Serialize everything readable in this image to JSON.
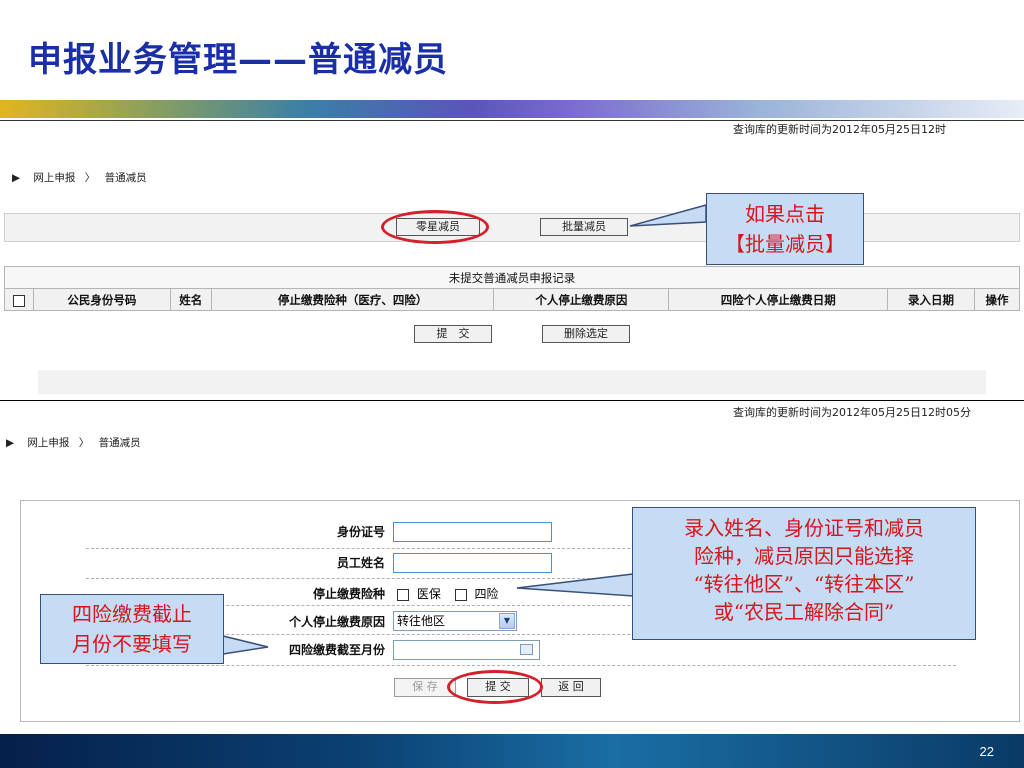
{
  "slide": {
    "title": "申报业务管理——普通减员",
    "page_number": "22"
  },
  "top_screen": {
    "update_time": "查询库的更新时间为2012年05月25日12时",
    "breadcrumb": {
      "arrow": "▶",
      "root": "网上申报",
      "sep": "〉",
      "current": "普通减员"
    },
    "buttons": {
      "zero_reduce": "零星减员",
      "batch_reduce": "批量减员"
    },
    "table": {
      "caption": "未提交普通减员申报记录",
      "headers": [
        "公民身份号码",
        "姓名",
        "停止缴费险种（医疗、四险）",
        "个人停止缴费原因",
        "四险个人停止缴费日期",
        "录入日期",
        "操作"
      ]
    },
    "actions": {
      "submit": "提　交",
      "delete_selected": "删除选定"
    }
  },
  "bottom_screen": {
    "update_time": "查询库的更新时间为2012年05月25日12时05分",
    "breadcrumb": {
      "arrow": "▶",
      "root": "网上申报",
      "sep": "〉",
      "current": "普通减员"
    },
    "form": {
      "id_label": "身份证号",
      "id_value": "",
      "name_label": "员工姓名",
      "name_value": "",
      "insurance_label": "停止缴费险种",
      "insurance_options": [
        {
          "label": "医保",
          "checked": false
        },
        {
          "label": "四险",
          "checked": false
        }
      ],
      "reason_label": "个人停止缴费原因",
      "reason_selected": "转往他区",
      "month_label": "四险缴费截至月份",
      "month_value": ""
    },
    "buttons": {
      "save": "保 存",
      "submit": "提 交",
      "back": "返 回"
    }
  },
  "callouts": {
    "batch": [
      "如果点击",
      "【批量减员】"
    ],
    "entry": [
      "录入姓名、身份证号和减员",
      "险种，减员原因只能选择",
      "“转往他区”、“转往本区”",
      "或“农民工解除合同”"
    ],
    "month": [
      "四险缴费截止",
      "月份不要填写"
    ]
  },
  "colors": {
    "title": "#1a2ea8",
    "callout_fill": "#c5dcf4",
    "callout_text": "#d9141b",
    "highlight_oval": "#d3202a"
  },
  "icons": [
    "breadcrumb-arrow-icon",
    "checkbox-icon",
    "dropdown-arrow-icon",
    "calendar-icon"
  ]
}
